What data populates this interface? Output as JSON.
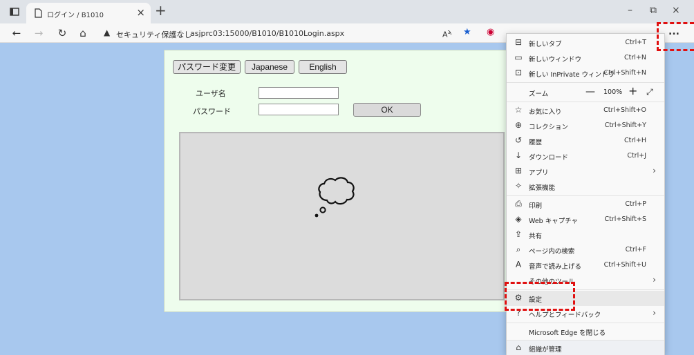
{
  "browser": {
    "tab_title": "ログイン / B1010",
    "new_tab_symbol": "+",
    "tab_close_symbol": "×",
    "address": {
      "security_label": "セキュリティ保護なし",
      "separator": "|",
      "url": "asjprc03:15000/B1010/B1010Login.aspx"
    },
    "window_controls": {
      "minimize": "–",
      "restore": "⧉",
      "close": "×"
    },
    "more_button": "..."
  },
  "page": {
    "buttons": {
      "change_password": "パスワード変更",
      "japanese": "Japanese",
      "english": "English"
    },
    "form": {
      "username_label": "ユーザ名",
      "password_label": "パスワード",
      "username_value": "",
      "password_value": "",
      "ok_label": "OK"
    }
  },
  "menu": {
    "items": [
      {
        "id": "new-tab",
        "icon": "⊟",
        "label": "新しいタブ",
        "shortcut": "Ctrl+T"
      },
      {
        "id": "new-window",
        "icon": "▭",
        "label": "新しいウィンドウ",
        "shortcut": "Ctrl+N"
      },
      {
        "id": "inprivate",
        "icon": "⊡",
        "label": "新しい InPrivate ウィンドウ",
        "shortcut": "Ctrl+Shift+N"
      }
    ],
    "zoom": {
      "label": "ズーム",
      "minus": "—",
      "value": "100%",
      "plus": "+",
      "fullscreen": "⤢"
    },
    "items2": [
      {
        "id": "favorites",
        "icon": "☆",
        "label": "お気に入り",
        "shortcut": "Ctrl+Shift+O"
      },
      {
        "id": "collections",
        "icon": "⊕",
        "label": "コレクション",
        "shortcut": "Ctrl+Shift+Y"
      },
      {
        "id": "history",
        "icon": "↺",
        "label": "履歴",
        "shortcut": "Ctrl+H"
      },
      {
        "id": "downloads",
        "icon": "↓",
        "label": "ダウンロード",
        "shortcut": "Ctrl+J"
      },
      {
        "id": "apps",
        "icon": "⊞",
        "label": "アプリ",
        "arrow": "›"
      },
      {
        "id": "extensions",
        "icon": "✧",
        "label": "拡張機能"
      }
    ],
    "items3": [
      {
        "id": "print",
        "icon": "⎙",
        "label": "印刷",
        "shortcut": "Ctrl+P"
      },
      {
        "id": "web-capture",
        "icon": "◈",
        "label": "Web キャプチャ",
        "shortcut": "Ctrl+Shift+S"
      },
      {
        "id": "share",
        "icon": "⇪",
        "label": "共有"
      },
      {
        "id": "find",
        "icon": "⌕",
        "label": "ページ内の検索",
        "shortcut": "Ctrl+F"
      },
      {
        "id": "read-aloud",
        "icon": "A",
        "label": "音声で読み上げる",
        "shortcut": "Ctrl+Shift+U"
      },
      {
        "id": "more-tools",
        "icon": "",
        "label": "その他のツール",
        "arrow": "›"
      }
    ],
    "items4": [
      {
        "id": "settings",
        "icon": "⚙",
        "label": "設定"
      },
      {
        "id": "help",
        "icon": "?",
        "label": "ヘルプとフィードバック",
        "arrow": "›"
      }
    ],
    "close_edge": "Microsoft Edge を閉じる",
    "managed": {
      "icon": "⌂",
      "label": "組織が管理"
    }
  },
  "colors": {
    "page_bg": "#a8c8ee",
    "panel_bg": "#eefded",
    "highlight": "#e01010"
  }
}
